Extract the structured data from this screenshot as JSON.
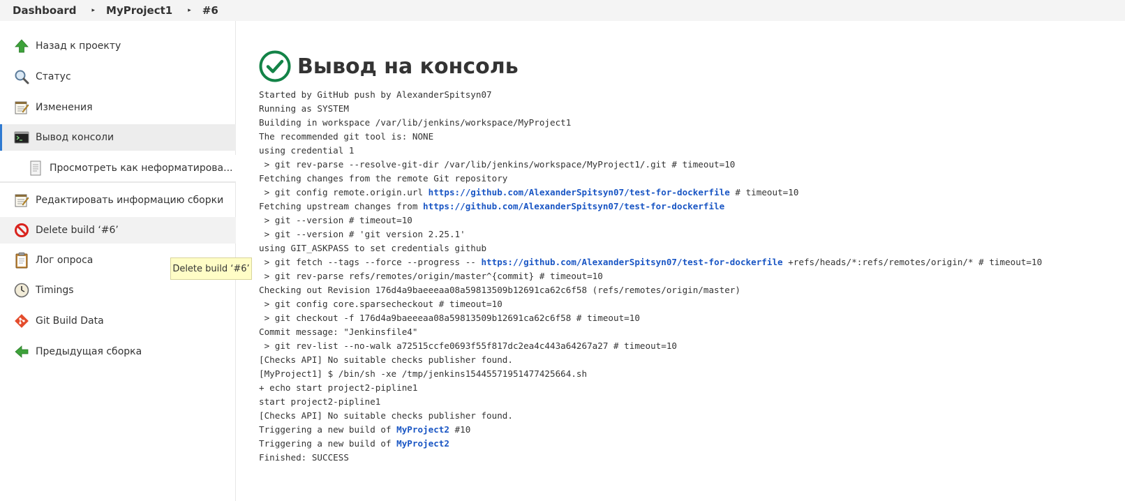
{
  "breadcrumb": {
    "items": [
      "Dashboard",
      "MyProject1",
      "#6"
    ]
  },
  "sidebar": {
    "items": [
      {
        "label": "Назад к проекту",
        "icon": "up-arrow-icon"
      },
      {
        "label": "Статус",
        "icon": "magnifier-icon"
      },
      {
        "label": "Изменения",
        "icon": "notepad-icon"
      },
      {
        "label": "Вывод консоли",
        "icon": "terminal-icon"
      },
      {
        "label": "Просмотреть как неформатирова...",
        "icon": "document-icon"
      },
      {
        "label": "Редактировать информацию сборки",
        "icon": "notepad-icon"
      },
      {
        "label": "Delete build ‘#6’",
        "icon": "no-entry-icon"
      },
      {
        "label": "Лог опроса",
        "icon": "clipboard-icon"
      },
      {
        "label": "Timings",
        "icon": "clock-icon"
      },
      {
        "label": "Git Build Data",
        "icon": "git-icon"
      },
      {
        "label": "Предыдущая сборка",
        "icon": "left-arrow-icon"
      }
    ]
  },
  "tooltip": {
    "text": "Delete build ‘#6’"
  },
  "main": {
    "title": "Вывод на консоль",
    "status_icon": "success-check-icon"
  },
  "console": {
    "lines": [
      [
        {
          "t": "Started by GitHub push by AlexanderSpitsyn07"
        }
      ],
      [
        {
          "t": "Running as SYSTEM"
        }
      ],
      [
        {
          "t": "Building in workspace /var/lib/jenkins/workspace/MyProject1"
        }
      ],
      [
        {
          "t": "The recommended git tool is: NONE"
        }
      ],
      [
        {
          "t": "using credential 1"
        }
      ],
      [
        {
          "t": " > git rev-parse --resolve-git-dir /var/lib/jenkins/workspace/MyProject1/.git # timeout=10"
        }
      ],
      [
        {
          "t": "Fetching changes from the remote Git repository"
        }
      ],
      [
        {
          "t": " > git config remote.origin.url "
        },
        {
          "t": "https://github.com/AlexanderSpitsyn07/test-for-dockerfile",
          "link": true
        },
        {
          "t": " # timeout=10"
        }
      ],
      [
        {
          "t": "Fetching upstream changes from "
        },
        {
          "t": "https://github.com/AlexanderSpitsyn07/test-for-dockerfile",
          "link": true
        }
      ],
      [
        {
          "t": " > git --version # timeout=10"
        }
      ],
      [
        {
          "t": " > git --version # 'git version 2.25.1'"
        }
      ],
      [
        {
          "t": "using GIT_ASKPASS to set credentials github"
        }
      ],
      [
        {
          "t": " > git fetch --tags --force --progress -- "
        },
        {
          "t": "https://github.com/AlexanderSpitsyn07/test-for-dockerfile",
          "link": true
        },
        {
          "t": " +refs/heads/*:refs/remotes/origin/* # timeout=10"
        }
      ],
      [
        {
          "t": " > git rev-parse refs/remotes/origin/master^{commit} # timeout=10"
        }
      ],
      [
        {
          "t": "Checking out Revision 176d4a9baeeeaa08a59813509b12691ca62c6f58 (refs/remotes/origin/master)"
        }
      ],
      [
        {
          "t": " > git config core.sparsecheckout # timeout=10"
        }
      ],
      [
        {
          "t": " > git checkout -f 176d4a9baeeeaa08a59813509b12691ca62c6f58 # timeout=10"
        }
      ],
      [
        {
          "t": "Commit message: \"Jenkinsfile4\""
        }
      ],
      [
        {
          "t": " > git rev-list --no-walk a72515ccfe0693f55f817dc2ea4c443a64267a27 # timeout=10"
        }
      ],
      [
        {
          "t": "[Checks API] No suitable checks publisher found."
        }
      ],
      [
        {
          "t": "[MyProject1] $ /bin/sh -xe /tmp/jenkins15445571951477425664.sh"
        }
      ],
      [
        {
          "t": "+ echo start project2-pipline1"
        }
      ],
      [
        {
          "t": "start project2-pipline1"
        }
      ],
      [
        {
          "t": "[Checks API] No suitable checks publisher found."
        }
      ],
      [
        {
          "t": "Triggering a new build of "
        },
        {
          "t": "MyProject2",
          "link": true
        },
        {
          "t": " #10"
        }
      ],
      [
        {
          "t": "Triggering a new build of "
        },
        {
          "t": "MyProject2",
          "link": true
        }
      ],
      [
        {
          "t": "Finished: SUCCESS"
        }
      ]
    ]
  },
  "colors": {
    "link": "#1a56c4",
    "success": "#138347",
    "active_indicator": "#2f7ad1",
    "tooltip_bg": "#fffdc6"
  }
}
